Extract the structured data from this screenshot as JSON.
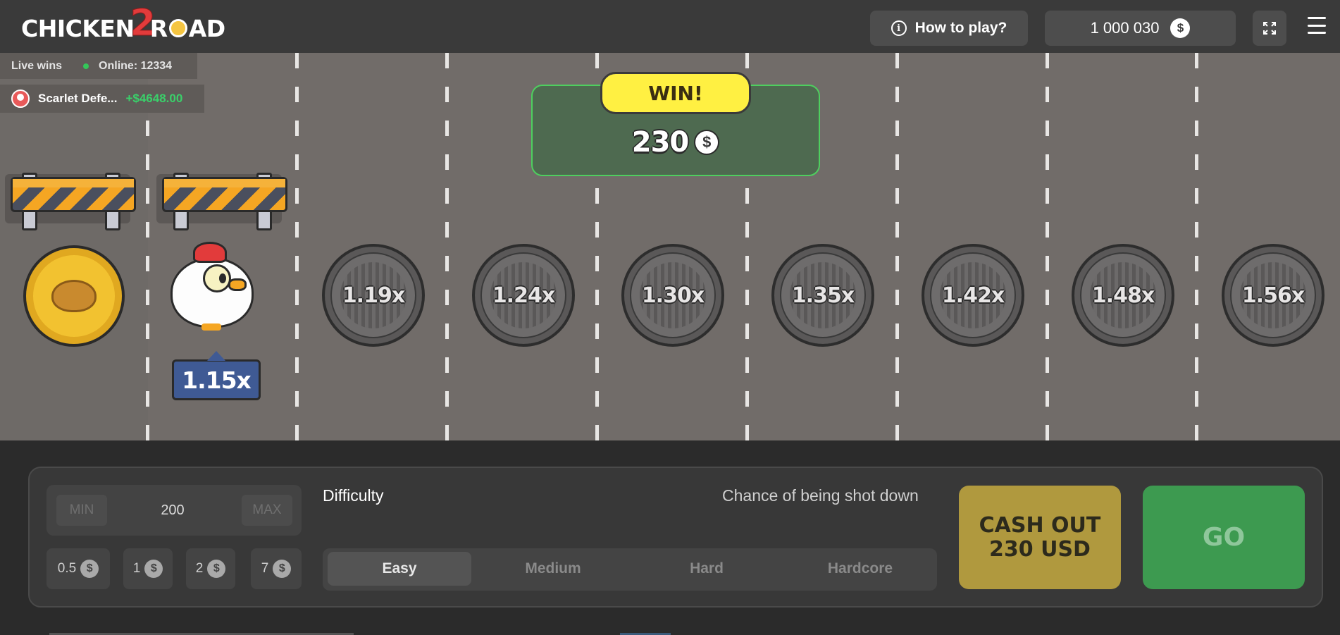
{
  "header": {
    "logo_text_1": "CHICKEN",
    "logo_text_2": "2",
    "logo_text_3": "R",
    "logo_text_4": "AD",
    "how_to_play": "How to play?",
    "balance": "1 000 030",
    "currency_symbol": "$"
  },
  "live": {
    "label": "Live wins",
    "online": "Online: 12334",
    "latest_winner": "Scarlet Defe...",
    "latest_amount": "+$4648.00"
  },
  "game": {
    "current_multiplier": "1.15x",
    "win_label": "WIN!",
    "win_amount": "230",
    "win_currency": "$",
    "multipliers": [
      "1.19x",
      "1.24x",
      "1.30x",
      "1.35x",
      "1.42x",
      "1.48x",
      "1.56x"
    ]
  },
  "controls": {
    "min_label": "MIN",
    "max_label": "MAX",
    "bet_value": "200",
    "chips": [
      "0.5",
      "1",
      "2",
      "7"
    ],
    "chip_currency": "$",
    "difficulty_label": "Difficulty",
    "chance_label": "Chance of being shot down",
    "difficulties": [
      "Easy",
      "Medium",
      "Hard",
      "Hardcore"
    ],
    "selected_difficulty": "Easy",
    "cashout_line1": "CASH OUT",
    "cashout_line2": "230 USD",
    "go_label": "GO"
  },
  "colors": {
    "road": "#716c69",
    "win_accent": "#4ecf5f",
    "cashout": "#b0993e",
    "go": "#3d9a50",
    "multiplier_badge": "#3f5a94"
  }
}
